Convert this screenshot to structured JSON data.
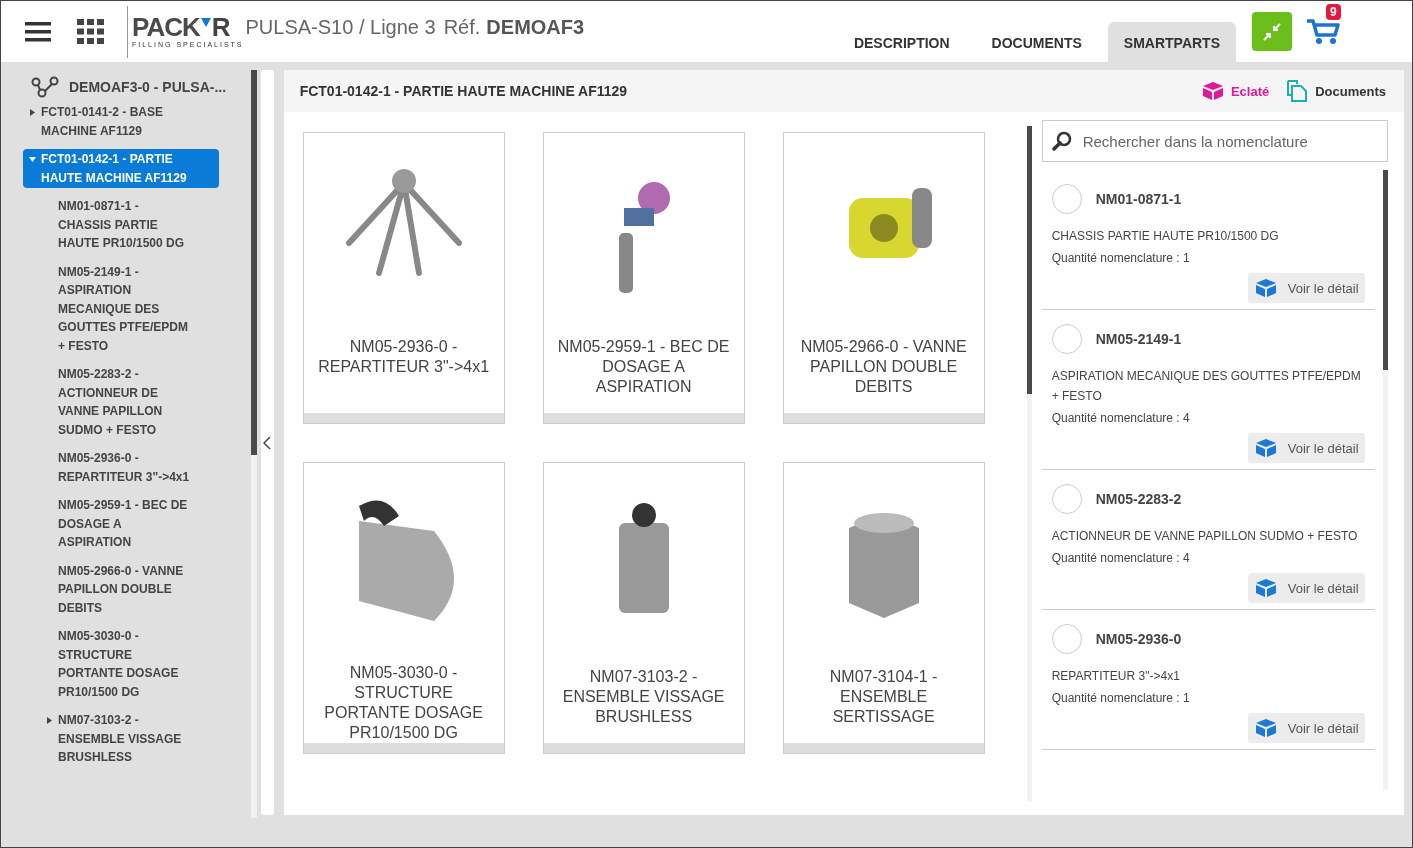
{
  "header": {
    "logo": {
      "left": "PACK",
      "right": "R",
      "tagline": "FILLING SPECIALISTS"
    },
    "title": "PULSA-S10 / Ligne 3",
    "ref_label": "Réf.",
    "ref": "DEMOAF3",
    "tabs": [
      {
        "label": "DESCRIPTION",
        "selected": false
      },
      {
        "label": "DOCUMENTS",
        "selected": false
      },
      {
        "label": "SMARTPARTS",
        "selected": true
      }
    ],
    "cart_count": "9"
  },
  "tree": {
    "root": "DEMOAF3-0 - PULSA-...",
    "items": [
      {
        "label": "FCT01-0141-2 - BASE MACHINE AF1129",
        "expanded": false,
        "selected": false
      },
      {
        "label": "FCT01-0142-1 - PARTIE HAUTE MACHINE AF1129",
        "expanded": true,
        "selected": true,
        "children": [
          {
            "label": "NM01-0871-1 - CHASSIS PARTIE HAUTE PR10/1500 DG",
            "selected": false
          },
          {
            "label": "NM05-2149-1 - ASPIRATION MECANIQUE DES GOUTTES PTFE/EPDM + FESTO",
            "selected": false
          },
          {
            "label": "NM05-2283-2 - ACTIONNEUR DE VANNE PAPILLON SUDMO + FESTO",
            "selected": false
          },
          {
            "label": "NM05-2936-0 - REPARTITEUR 3\"->4x1",
            "selected": false
          },
          {
            "label": "NM05-2959-1 - BEC DE DOSAGE A ASPIRATION",
            "selected": false
          },
          {
            "label": "NM05-2966-0 - VANNE PAPILLON DOUBLE DEBITS",
            "selected": false
          },
          {
            "label": "NM05-3030-0 - STRUCTURE PORTANTE DOSAGE PR10/1500 DG",
            "selected": false
          },
          {
            "label": "NM07-3103-2 - ENSEMBLE VISSAGE BRUSHLESS",
            "expanded": false,
            "selected": false
          }
        ]
      }
    ]
  },
  "panel": {
    "title": "FCT01-0142-1 - PARTIE HAUTE MACHINE AF1129",
    "actions": [
      {
        "kind": "exploded",
        "label": "Eclaté"
      },
      {
        "kind": "documents",
        "label": "Documents"
      }
    ]
  },
  "cards": [
    {
      "label": "NM05-2936-0 - REPARTITEUR 3\"->4x1"
    },
    {
      "label": "NM05-2959-1 - BEC DE DOSAGE A ASPIRATION"
    },
    {
      "label": "NM05-2966-0 - VANNE PAPILLON DOUBLE DEBITS"
    },
    {
      "label": "NM05-3030-0 - STRUCTURE PORTANTE DOSAGE PR10/1500 DG"
    },
    {
      "label": "NM07-3103-2 - ENSEMBLE VISSAGE BRUSHLESS"
    },
    {
      "label": "NM07-3104-1 - ENSEMBLE SERTISSAGE"
    }
  ],
  "bom": {
    "search": {
      "placeholder": "Rechercher dans la nomenclature"
    },
    "items": [
      {
        "code": "NM01-0871-1",
        "description": "CHASSIS PARTIE HAUTE PR10/1500 DG",
        "quantity": "Quantité nomenclature : 1",
        "button": "Voir le détail",
        "checked": false
      },
      {
        "code": "NM05-2149-1",
        "description": "ASPIRATION MECANIQUE DES GOUTTES PTFE/EPDM + FESTO",
        "quantity": "Quantité nomenclature : 4",
        "button": "Voir le détail",
        "checked": false
      },
      {
        "code": "NM05-2283-2",
        "description": "ACTIONNEUR DE VANNE PAPILLON SUDMO + FESTO",
        "quantity": "Quantité nomenclature : 4",
        "button": "Voir le détail",
        "checked": false
      },
      {
        "code": "NM05-2936-0",
        "description": "REPARTITEUR 3\"->4x1",
        "quantity": "Quantité nomenclature : 1",
        "button": "Voir le détail",
        "checked": false
      }
    ]
  }
}
